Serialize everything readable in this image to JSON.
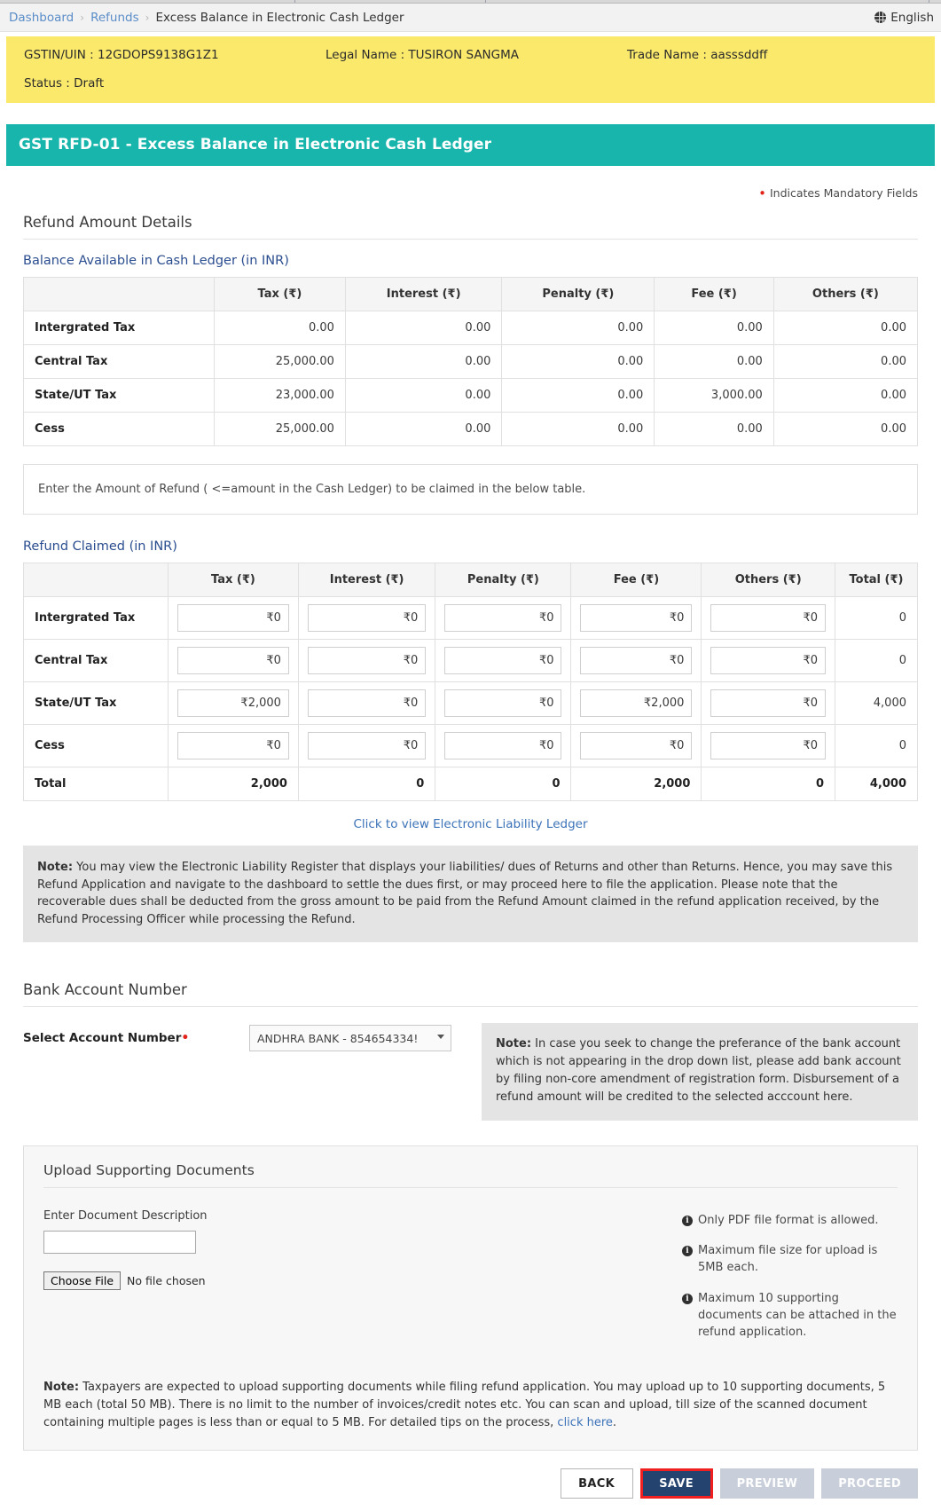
{
  "browser": {
    "tab_count": 4
  },
  "breadcrumb": {
    "items": [
      "Dashboard",
      "Refunds",
      "Excess Balance in Electronic Cash Ledger"
    ],
    "separator": "›"
  },
  "language": {
    "label": "English",
    "icon": "globe-icon"
  },
  "taxpayer": {
    "gstin_label": "GSTIN/UIN : 12GDOPS9138G1Z1",
    "legal_name_label": "Legal Name : TUSIRON SANGMA",
    "trade_name_label": "Trade Name : aasssddff",
    "status_label": "Status : Draft",
    "banner_color": "#fbe96b"
  },
  "form": {
    "title": "GST RFD-01 - Excess Balance in Electronic Cash Ledger",
    "accent_color": "#17b5ab",
    "mandatory_note": "Indicates Mandatory Fields",
    "section_title": "Refund Amount Details"
  },
  "balance_table": {
    "caption": "Balance Available in Cash Ledger (in INR)",
    "columns": [
      "",
      "Tax (₹)",
      "Interest (₹)",
      "Penalty (₹)",
      "Fee (₹)",
      "Others (₹)"
    ],
    "rows": [
      {
        "label": "Intergrated Tax",
        "values": [
          "0.00",
          "0.00",
          "0.00",
          "0.00",
          "0.00"
        ]
      },
      {
        "label": "Central Tax",
        "values": [
          "25,000.00",
          "0.00",
          "0.00",
          "0.00",
          "0.00"
        ]
      },
      {
        "label": "State/UT Tax",
        "values": [
          "23,000.00",
          "0.00",
          "0.00",
          "3,000.00",
          "0.00"
        ]
      },
      {
        "label": "Cess",
        "values": [
          "25,000.00",
          "0.00",
          "0.00",
          "0.00",
          "0.00"
        ]
      }
    ]
  },
  "instruction_box": {
    "text": "Enter the Amount of Refund ( <=amount in the Cash Ledger) to be claimed in the below table."
  },
  "claimed_table": {
    "caption": "Refund Claimed (in INR)",
    "columns": [
      "",
      "Tax (₹)",
      "Interest (₹)",
      "Penalty (₹)",
      "Fee (₹)",
      "Others (₹)",
      "Total (₹)"
    ],
    "rows": [
      {
        "label": "Intergrated Tax",
        "inputs": [
          "₹0",
          "₹0",
          "₹0",
          "₹0",
          "₹0"
        ],
        "total": "0"
      },
      {
        "label": "Central Tax",
        "inputs": [
          "₹0",
          "₹0",
          "₹0",
          "₹0",
          "₹0"
        ],
        "total": "0"
      },
      {
        "label": "State/UT Tax",
        "inputs": [
          "₹2,000",
          "₹0",
          "₹0",
          "₹2,000",
          "₹0"
        ],
        "total": "4,000"
      },
      {
        "label": "Cess",
        "inputs": [
          "₹0",
          "₹0",
          "₹0",
          "₹0",
          "₹0"
        ],
        "total": "0"
      }
    ],
    "total_row": {
      "label": "Total",
      "values": [
        "2,000",
        "0",
        "0",
        "2,000",
        "0",
        "4,000"
      ]
    }
  },
  "liability_link": {
    "label": "Click to view Electronic Liability Ledger"
  },
  "liability_note": {
    "prefix": "Note:",
    "text": " You may view the Electronic Liability Register that displays your liabilities/ dues of Returns and other than Returns. Hence, you may save this Refund Application and navigate to the dashboard to settle the dues first, or may proceed here to file the application. Please note that the recoverable dues shall be deducted from the gross amount to be paid from the Refund Amount claimed in the refund application received, by the Refund Processing Officer while processing the Refund."
  },
  "bank": {
    "section_title": "Bank Account Number",
    "field_label": "Select Account Number",
    "selected_option": "ANDHRA BANK - 854654334!",
    "options": [
      "ANDHRA BANK - 854654334!"
    ],
    "note_prefix": "Note:",
    "note_text": " In case you seek to change the preferance of the bank account which is not appearing in the drop down list, please add bank account by filing non-core amendment of registration form. Disbursement of a refund amount will be credited to the selected acccount here."
  },
  "upload": {
    "title": "Upload Supporting Documents",
    "desc_label": "Enter Document Description",
    "desc_value": "",
    "choose_file_label": "Choose File",
    "no_file_label": "No file chosen",
    "hints": [
      "Only PDF file format is allowed.",
      "Maximum file size for upload is 5MB each.",
      "Maximum 10 supporting documents can be attached in the refund application."
    ]
  },
  "bottom_note": {
    "prefix": "Note:",
    "text": " Taxpayers are expected to upload supporting documents while filing refund application. You may upload up to 10 supporting documents, 5 MB each (total 50 MB). There is no limit to the number of invoices/credit notes etc. You can scan and upload, till size of the scanned document containing multiple pages is less than or equal to 5 MB. For detailed tips on the process, ",
    "link_label": "click here",
    "suffix": "."
  },
  "buttons": {
    "back": "BACK",
    "save": "SAVE",
    "preview": "PREVIEW",
    "proceed": "PROCEED",
    "save_highlight_color": "#f02020",
    "save_bg_color": "#24436e"
  }
}
